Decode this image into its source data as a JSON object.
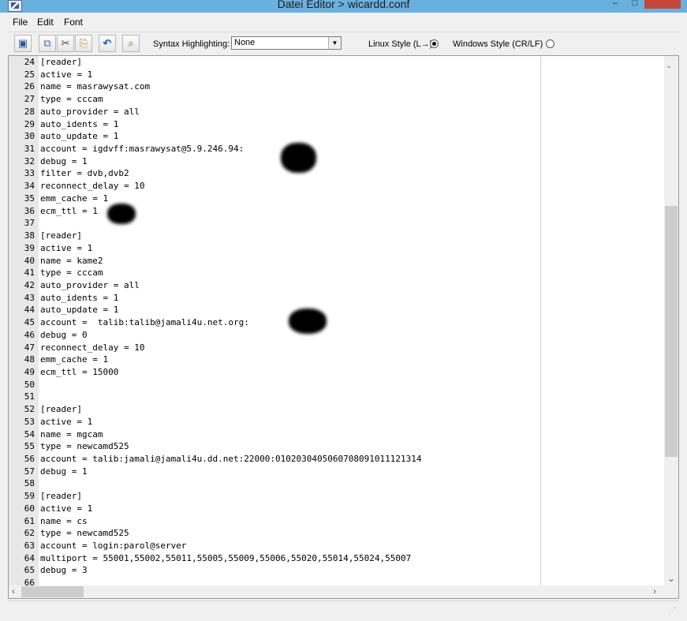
{
  "window": {
    "title": "Datei Editor > wicardd.conf"
  },
  "menu": [
    "File",
    "Edit",
    "Font"
  ],
  "toolbar": {
    "icons": [
      "save-icon",
      "copy-icon",
      "cut-icon",
      "paste-icon",
      "undo-icon",
      "find-icon"
    ],
    "syntax_label": "Syntax Highlighting:",
    "syntax_value": "None",
    "linux_label": "Linux Style (L→)",
    "linux_selected": true,
    "windows_label": "Windows Style (CR/LF)",
    "windows_selected": false
  },
  "editor": {
    "lines": [
      {
        "n": "24",
        "t": "[reader]"
      },
      {
        "n": "25",
        "t": "active = 1"
      },
      {
        "n": "26",
        "t": "name = masrawysat.com"
      },
      {
        "n": "27",
        "t": "type = cccam"
      },
      {
        "n": "28",
        "t": "auto_provider = all"
      },
      {
        "n": "29",
        "t": "auto_idents = 1"
      },
      {
        "n": "30",
        "t": "auto_update = 1"
      },
      {
        "n": "31",
        "t": "account = igdvff:masrawysat@5.9.246.94:"
      },
      {
        "n": "32",
        "t": "debug = 1"
      },
      {
        "n": "33",
        "t": "filter = dvb,dvb2"
      },
      {
        "n": "34",
        "t": "reconnect_delay = 10"
      },
      {
        "n": "35",
        "t": "emm_cache = 1"
      },
      {
        "n": "36",
        "t": "ecm_ttl = 1"
      },
      {
        "n": "37",
        "t": ""
      },
      {
        "n": "38",
        "t": "[reader]"
      },
      {
        "n": "39",
        "t": "active = 1"
      },
      {
        "n": "40",
        "t": "name = kame2"
      },
      {
        "n": "41",
        "t": "type = cccam"
      },
      {
        "n": "42",
        "t": "auto_provider = all"
      },
      {
        "n": "43",
        "t": "auto_idents = 1"
      },
      {
        "n": "44",
        "t": "auto_update = 1"
      },
      {
        "n": "45",
        "t": "account =  talib:talib@jamali4u.net.org:"
      },
      {
        "n": "46",
        "t": "debug = 0"
      },
      {
        "n": "47",
        "t": "reconnect_delay = 10"
      },
      {
        "n": "48",
        "t": "emm_cache = 1"
      },
      {
        "n": "49",
        "t": "ecm_ttl = 15000"
      },
      {
        "n": "50",
        "t": ""
      },
      {
        "n": "51",
        "t": ""
      },
      {
        "n": "52",
        "t": "[reader]"
      },
      {
        "n": "53",
        "t": "active = 1"
      },
      {
        "n": "54",
        "t": "name = mgcam"
      },
      {
        "n": "55",
        "t": "type = newcamd525"
      },
      {
        "n": "56",
        "t": "account = talib:jamali@jamali4u.dd.net:22000:0102030405060708091011121314"
      },
      {
        "n": "57",
        "t": "debug = 1"
      },
      {
        "n": "58",
        "t": ""
      },
      {
        "n": "59",
        "t": "[reader]"
      },
      {
        "n": "60",
        "t": "active = 1"
      },
      {
        "n": "61",
        "t": "name = cs"
      },
      {
        "n": "62",
        "t": "type = newcamd525"
      },
      {
        "n": "63",
        "t": "account = login:parol@server"
      },
      {
        "n": "64",
        "t": "multiport = 55001,55002,55011,55005,55009,55006,55020,55014,55024,55007"
      },
      {
        "n": "65",
        "t": "debug = 3"
      },
      {
        "n": "66",
        "t": ""
      }
    ]
  }
}
